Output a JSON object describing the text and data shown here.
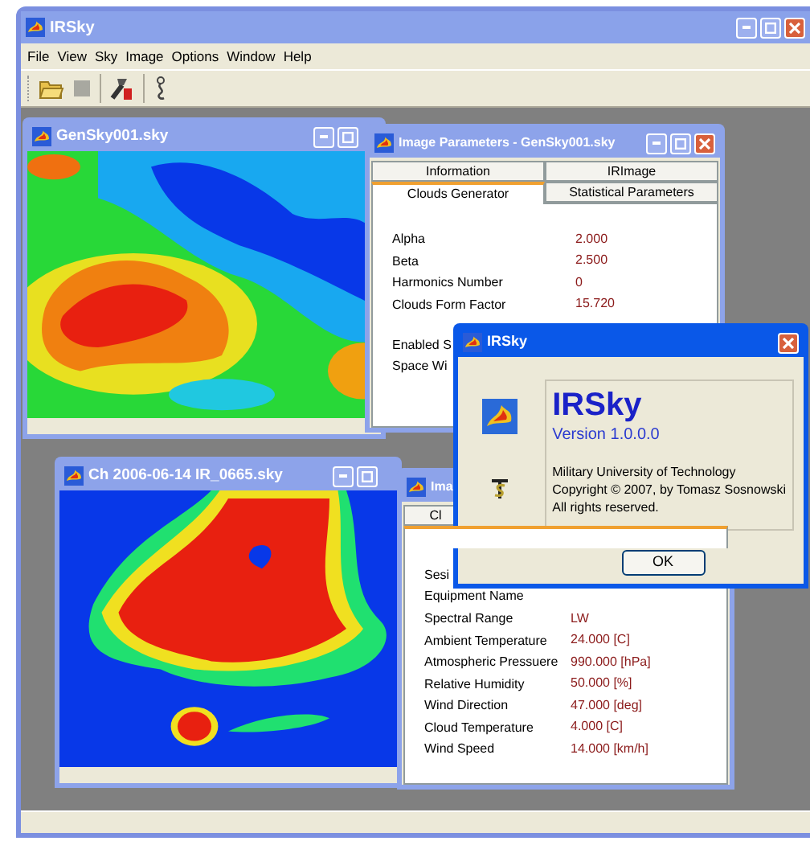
{
  "app": {
    "title": "IRSky",
    "menu": [
      "File",
      "View",
      "Sky",
      "Image",
      "Options",
      "Window",
      "Help"
    ]
  },
  "documents": [
    {
      "title": "GenSky001.sky",
      "kind": "generated"
    },
    {
      "title": "Ch 2006-06-14 IR_0665.sky",
      "kind": "measured"
    }
  ],
  "parameter_windows": [
    {
      "title": "Image Parameters - GenSky001.sky",
      "tab_rows": [
        [
          {
            "label": "Information",
            "selected": false
          },
          {
            "label": "IRImage",
            "selected": false
          }
        ],
        [
          {
            "label": "Clouds Generator",
            "selected": true
          },
          {
            "label": "Statistical Parameters",
            "selected": false
          }
        ]
      ],
      "rows": [
        {
          "label": "Alpha",
          "value": "2.000"
        },
        {
          "label": "Beta",
          "value": "2.500"
        },
        {
          "label": "Harmonics Number",
          "value": "0"
        },
        {
          "label": "Clouds Form Factor",
          "value": "15.720"
        },
        {
          "label": "Enabled S",
          "gap": true
        },
        {
          "label": "Space Wi"
        }
      ]
    },
    {
      "title": "Ima",
      "tab_rows": [
        [
          {
            "label": "Cl",
            "selected": false
          }
        ],
        [
          {
            "selected": true
          }
        ]
      ],
      "rows": [
        {
          "label": "Sesi"
        },
        {
          "label": "Equipment Name"
        },
        {
          "label": "Spectral Range",
          "value": "LW"
        },
        {
          "label": "Ambient Temperature",
          "value": "24.000 [C]"
        },
        {
          "label": "Atmospheric Pressuere",
          "value": "990.000 [hPa]"
        },
        {
          "label": "Relative Humidity",
          "value": "50.000 [%]"
        },
        {
          "label": "Wind Direction",
          "value": "47.000 [deg]"
        },
        {
          "label": "Cloud Temperature",
          "value": "4.000 [C]"
        },
        {
          "label": "Wind Speed",
          "value": "14.000 [km/h]"
        }
      ]
    }
  ],
  "about_dialog": {
    "title": "IRSky",
    "product": "IRSky",
    "version": "Version 1.0.0.0",
    "lines": [
      "Military University of Technology",
      "Copyright © 2007, by Tomasz Sosnowski",
      "All rights reserved."
    ],
    "button": "OK"
  }
}
